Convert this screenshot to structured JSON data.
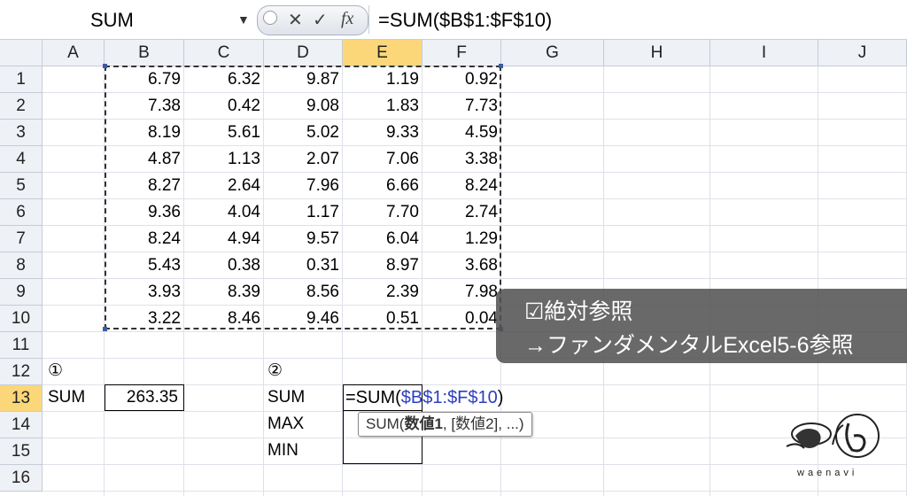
{
  "formula_bar": {
    "name_box": "SUM",
    "cancel_glyph": "✕",
    "enter_glyph": "✓",
    "fx_glyph": "fx",
    "formula": "=SUM($B$1:$F$10)"
  },
  "columns": [
    "A",
    "B",
    "C",
    "D",
    "E",
    "F",
    "G",
    "H",
    "I",
    "J"
  ],
  "active_column": "E",
  "rows": [
    "1",
    "2",
    "3",
    "4",
    "5",
    "6",
    "7",
    "8",
    "9",
    "10",
    "11",
    "12",
    "13",
    "14",
    "15",
    "16"
  ],
  "active_row": "13",
  "data_range": [
    [
      "6.79",
      "6.32",
      "9.87",
      "1.19",
      "0.92"
    ],
    [
      "7.38",
      "0.42",
      "9.08",
      "1.83",
      "7.73"
    ],
    [
      "8.19",
      "5.61",
      "5.02",
      "9.33",
      "4.59"
    ],
    [
      "4.87",
      "1.13",
      "2.07",
      "7.06",
      "3.38"
    ],
    [
      "8.27",
      "2.64",
      "7.96",
      "6.66",
      "8.24"
    ],
    [
      "9.36",
      "4.04",
      "1.17",
      "7.70",
      "2.74"
    ],
    [
      "8.24",
      "4.94",
      "9.57",
      "6.04",
      "1.29"
    ],
    [
      "5.43",
      "0.38",
      "0.31",
      "8.97",
      "3.68"
    ],
    [
      "3.93",
      "8.39",
      "8.56",
      "2.39",
      "7.98"
    ],
    [
      "3.22",
      "8.46",
      "9.46",
      "0.51",
      "0.04"
    ]
  ],
  "cells": {
    "A12": "①",
    "A13": "SUM",
    "B13": "263.35",
    "D12": "②",
    "D13": "SUM",
    "D14": "MAX",
    "D15": "MIN",
    "E13_prefix": "=SUM(",
    "E13_ref": "$B$1:$F$10",
    "E13_suffix": ")"
  },
  "tooltip": {
    "fn": "SUM(",
    "arg1": "数値1",
    "rest": ", [数値2], ...)"
  },
  "overlay": {
    "line1": "☑絶対参照",
    "line2": "→ファンダメンタルExcel5-6参照"
  },
  "logo": {
    "caption": "waenavi"
  },
  "colors": {
    "active_header": "#fbd77a",
    "ref_blue": "#2a3fbf",
    "overlay_bg": "#505050"
  }
}
